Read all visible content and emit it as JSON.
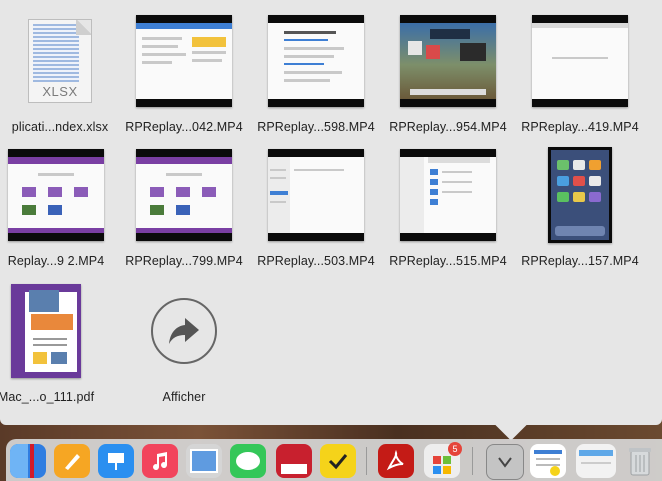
{
  "stack": {
    "files": [
      {
        "name": "plicati...ndex.xlsx",
        "kind": "xlsx"
      },
      {
        "name": "RPReplay...042.MP4",
        "kind": "video"
      },
      {
        "name": "RPReplay...598.MP4",
        "kind": "video"
      },
      {
        "name": "RPReplay...954.MP4",
        "kind": "video"
      },
      {
        "name": "RPReplay...419.MP4",
        "kind": "video"
      },
      {
        "name": "Replay...9 2.MP4",
        "kind": "video"
      },
      {
        "name": "RPReplay...799.MP4",
        "kind": "video"
      },
      {
        "name": "RPReplay...503.MP4",
        "kind": "video"
      },
      {
        "name": "RPReplay...515.MP4",
        "kind": "video"
      },
      {
        "name": "RPReplay...157.MP4",
        "kind": "video"
      },
      {
        "name": "Mac_...o_111.pdf",
        "kind": "pdf"
      }
    ],
    "xlsx_icon_text": "XLSX",
    "show_more_label": "Afficher"
  },
  "dock": {
    "apps": [
      {
        "name": "finder-icon",
        "color": "#2f7de1"
      },
      {
        "name": "pages-icon",
        "color": "#f6a623"
      },
      {
        "name": "keynote-icon",
        "color": "#2a8ff0"
      },
      {
        "name": "music-icon",
        "color": "#f2445c"
      },
      {
        "name": "preview-icon",
        "color": "#d5d5d5"
      },
      {
        "name": "messages-icon",
        "color": "#34c759"
      },
      {
        "name": "photo-booth-icon",
        "color": "#c8202e"
      },
      {
        "name": "checkmark-app-icon",
        "color": "#f5d31a"
      },
      {
        "name": "acrobat-icon",
        "color": "#c41b16"
      },
      {
        "name": "app-store-updates-icon",
        "color": "#eeeeee"
      },
      {
        "name": "downloads-stack-icon",
        "color": "#c4c4c4"
      },
      {
        "name": "document-stack-icon",
        "color": "#ffffff"
      },
      {
        "name": "window-thumbnail-icon",
        "color": "#f2f2f2"
      },
      {
        "name": "trash-icon",
        "color": "#cfd2d4"
      }
    ],
    "badge_count": "5"
  }
}
